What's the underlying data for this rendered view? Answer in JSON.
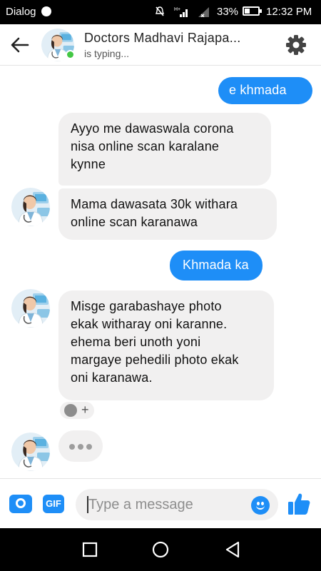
{
  "status_bar": {
    "carrier": "Dialog",
    "battery": "33%",
    "battery_level": 0.33,
    "time": "12:32 PM"
  },
  "header": {
    "contact_name": "Doctors Madhavi Rajapa...",
    "contact_status": "is typing...",
    "icons": [
      "back-arrow-icon",
      "avatar",
      "online-dot",
      "gear-icon"
    ]
  },
  "messages": [
    {
      "direction": "outgoing",
      "text": "e khmada"
    },
    {
      "direction": "incoming",
      "lines": [
        "Ayyo me dawaswala corona",
        "nisa online scan karalane",
        "kynne"
      ]
    },
    {
      "direction": "incoming",
      "lines": [
        "Mama dawasata 30k withara",
        "online scan karanawa"
      ]
    },
    {
      "direction": "outgoing",
      "text": "Khmada ka"
    },
    {
      "direction": "incoming",
      "lines": [
        "Misge garabashaye photo",
        "ekak witharay oni karanne.",
        "ehema beri unoth yoni",
        "margaye pehedili photo ekak",
        "oni karanawa."
      ]
    }
  ],
  "reaction": {
    "plus": "+"
  },
  "composer": {
    "placeholder": "Type a message",
    "gif_label": "GIF",
    "icons": [
      "camera-icon",
      "gif-icon",
      "emoji-icon",
      "thumbs-up-icon"
    ]
  },
  "colors": {
    "accent": "#1e8ef7",
    "incoming_bubble": "#f1f0f0",
    "online": "#43c744",
    "bars": "#000000"
  },
  "nav_bar": {
    "icons": [
      "recent-apps-icon",
      "home-icon",
      "back-icon"
    ]
  }
}
